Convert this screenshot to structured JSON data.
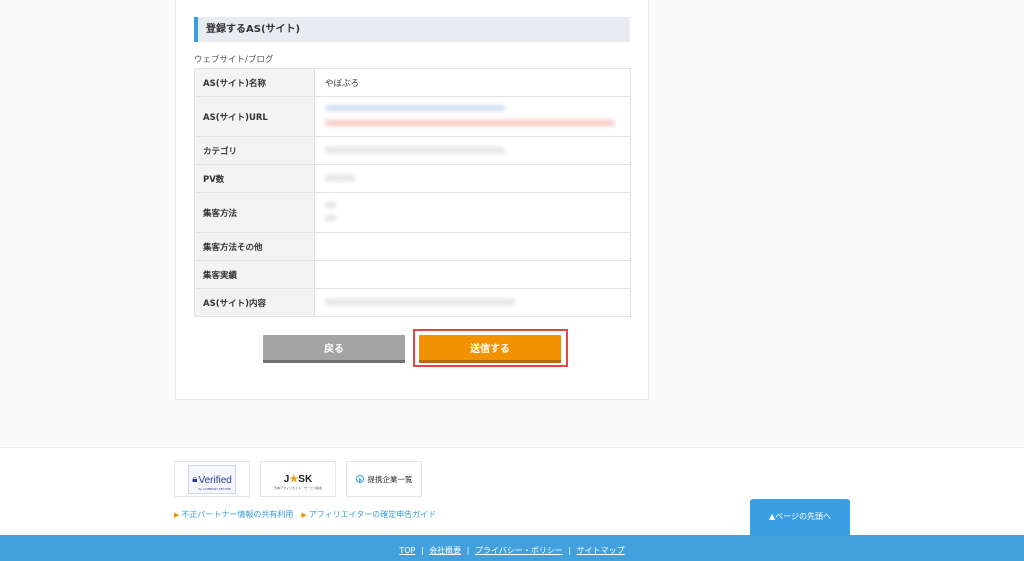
{
  "section": {
    "heading": "登録するAS(サイト)",
    "sub_label": "ウェブサイト/ブログ"
  },
  "table": {
    "rows": [
      {
        "label": "AS(サイト)名称",
        "value": "やぼぶろ",
        "redacted": false
      },
      {
        "label": "AS(サイト)URL",
        "value": "",
        "redacted": true
      },
      {
        "label": "カテゴリ",
        "value": "",
        "redacted": true
      },
      {
        "label": "PV数",
        "value": "",
        "redacted": true
      },
      {
        "label": "集客方法",
        "value": "",
        "redacted": true
      },
      {
        "label": "集客方法その他",
        "value": "",
        "redacted": true
      },
      {
        "label": "集客実績",
        "value": "",
        "redacted": true
      },
      {
        "label": "AS(サイト)内容",
        "value": "",
        "redacted": true
      }
    ]
  },
  "buttons": {
    "back": "戻る",
    "submit": "送信する"
  },
  "colors": {
    "accent_blue": "#3a9ee2",
    "submit_orange": "#f39200",
    "back_gray": "#a3a3a3",
    "highlight_red": "#e64545",
    "footer_blue": "#42a0dc"
  },
  "footer": {
    "badges": {
      "verified": "Verified",
      "verified_sub": "by COMPANY SECURE",
      "jask": "JASK",
      "jask_sub": "日本アフィリエイト・サービス協会",
      "partners": "提携企業一覧"
    },
    "links": [
      "不正パートナー情報の共有利用",
      "アフィリエイターの確定申告ガイド"
    ],
    "page_top": "▲ページの先頭へ",
    "bottom_links": [
      "TOP",
      "会社概要",
      "プライバシー・ポリシー",
      "サイトマップ"
    ]
  }
}
